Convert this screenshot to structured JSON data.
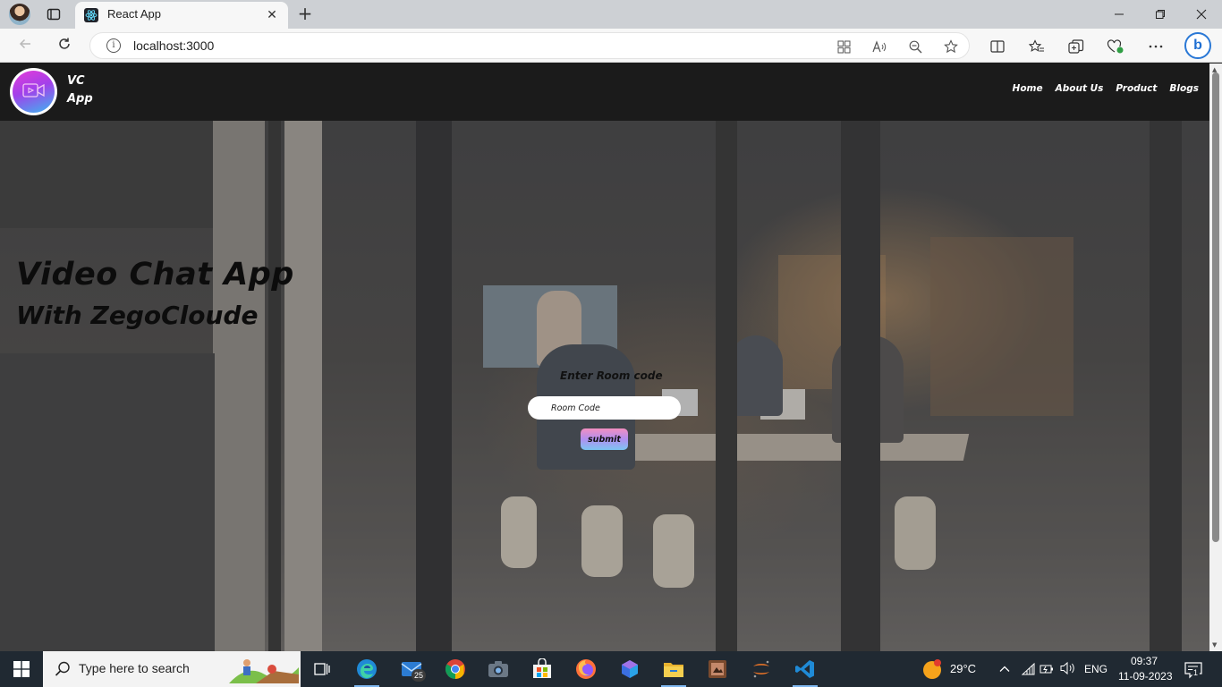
{
  "browser": {
    "tab_title": "React App",
    "url": "localhost:3000",
    "new_tab_symbol": "+",
    "close_symbol": "✕"
  },
  "app": {
    "brand_line1": "VC",
    "brand_line2": "App",
    "nav": [
      "Home",
      "About Us",
      "Product",
      "Blogs"
    ],
    "headline_line1": "Video Chat App",
    "headline_line2": "With ZegoCloude",
    "room_label": "Enter Room code",
    "room_placeholder": "Room Code",
    "submit_label": "submit"
  },
  "taskbar": {
    "search_placeholder": "Type here to search",
    "mail_badge": "25",
    "weather": "29°C",
    "language": "ENG",
    "time": "09:37",
    "date": "11-09-2023",
    "notification_count": "1"
  },
  "colors": {
    "navbar": "#1b1b1b",
    "logo_gradient": [
      "#e53bd8",
      "#a240ea",
      "#3cb6f0"
    ],
    "submit_gradient": [
      "#f28fc1",
      "#b18ff0",
      "#7cc5f2"
    ],
    "taskbar": "#202932",
    "weather_sun": "#f5a21b"
  },
  "icons": [
    "back-arrow-icon",
    "refresh-icon",
    "info-icon",
    "app-grid-icon",
    "read-aloud-icon",
    "zoom-out-icon",
    "favorite-star-icon",
    "split-screen-icon",
    "favorites-icon",
    "collections-icon",
    "browser-essentials-icon",
    "more-icon",
    "bing-icon",
    "video-camera-icon",
    "windows-start-icon",
    "search-icon",
    "task-view-icon",
    "edge-icon",
    "mail-icon",
    "chrome-icon",
    "camera-icon",
    "store-icon",
    "firefox-icon",
    "copilot-icon",
    "file-explorer-icon",
    "paint-icon",
    "jupyter-icon",
    "vscode-icon",
    "chevron-up-icon",
    "wifi-icon",
    "battery-icon",
    "volume-icon",
    "notification-icon"
  ]
}
